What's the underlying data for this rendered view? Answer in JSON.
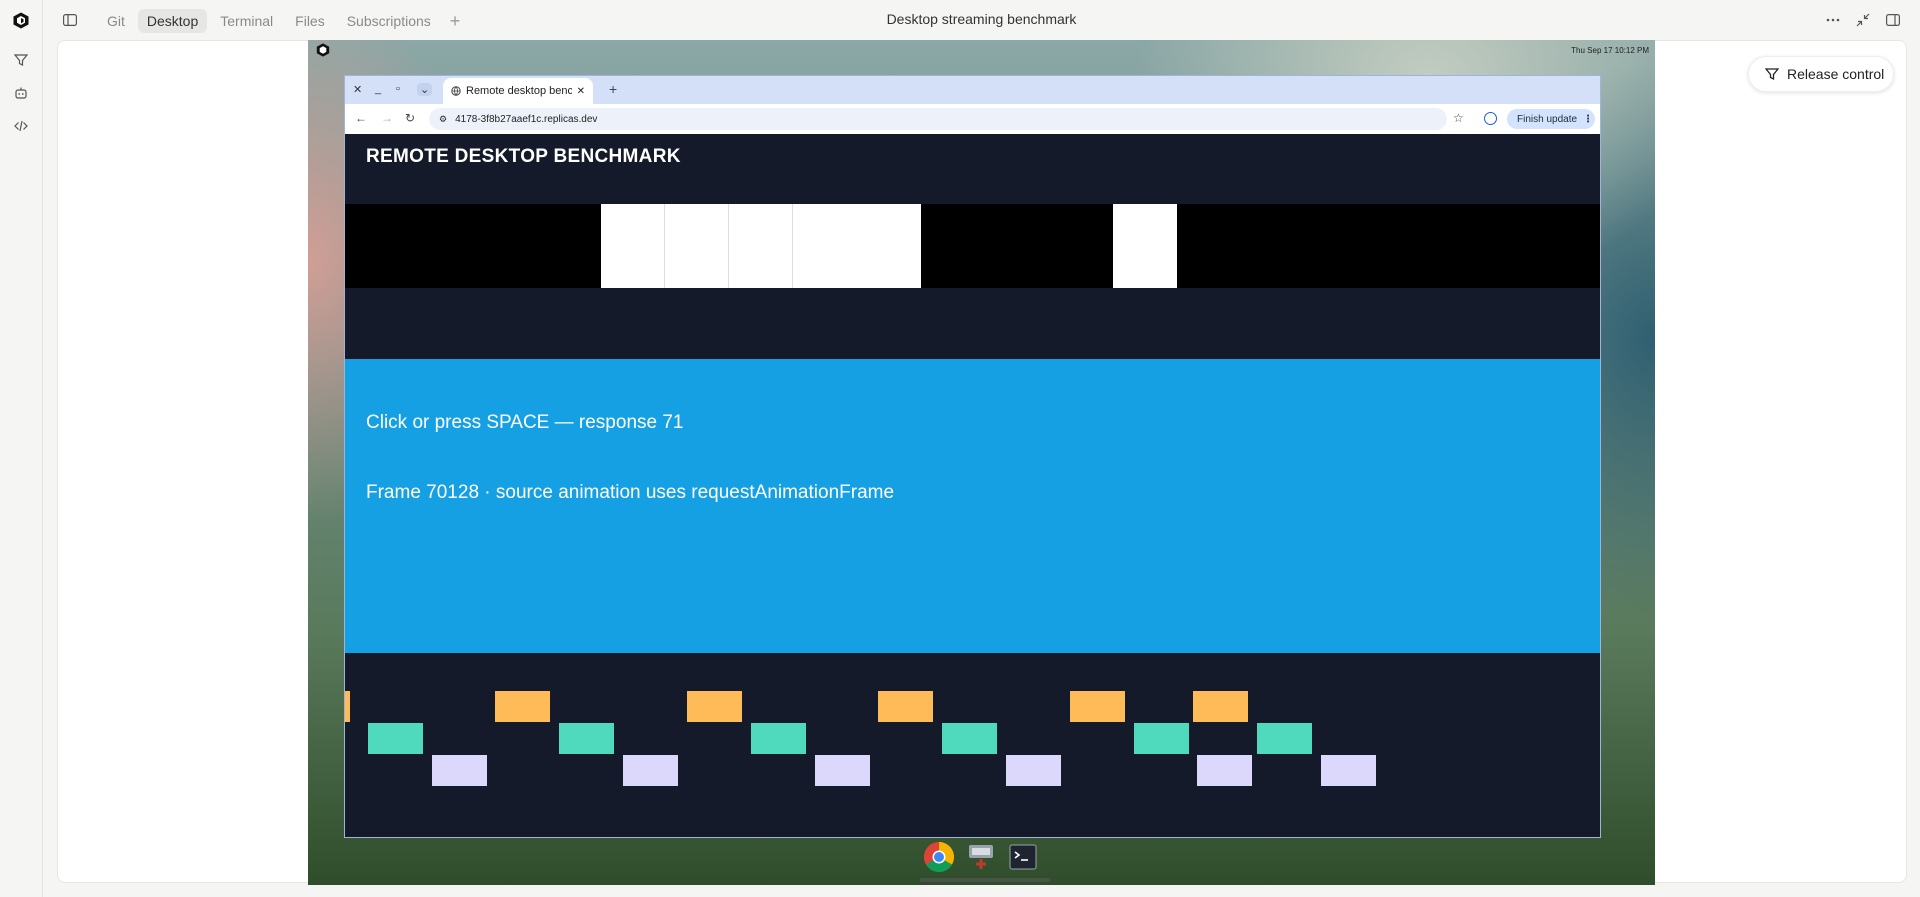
{
  "rail": {
    "items": [
      "logo-icon",
      "filter-icon",
      "bot-icon",
      "code-icon"
    ]
  },
  "header": {
    "tabs": [
      {
        "label": "Git",
        "active": false
      },
      {
        "label": "Desktop",
        "active": true
      },
      {
        "label": "Terminal",
        "active": false
      },
      {
        "label": "Files",
        "active": false
      },
      {
        "label": "Subscriptions",
        "active": false
      }
    ],
    "title": "Desktop streaming benchmark"
  },
  "release_control": {
    "label": "Release control"
  },
  "desktop": {
    "clock": "Thu Sep 17  10:12 PM",
    "browser": {
      "tab_title": "Remote desktop bench",
      "url": "4178-3f8b27aaef1c.replicas.dev",
      "finish_update": "Finish update"
    },
    "page": {
      "title": "REMOTE DESKTOP BENCHMARK",
      "response_line": "Click or press SPACE — response 71",
      "frame_line": "Frame 70128 · source animation uses requestAnimationFrame"
    }
  },
  "colors": {
    "accent_blue": "#16a0e4",
    "page_bg": "#141a29",
    "orange": "#ffbb57",
    "green": "#4fd9bd",
    "lavender": "#dcd8fb"
  }
}
